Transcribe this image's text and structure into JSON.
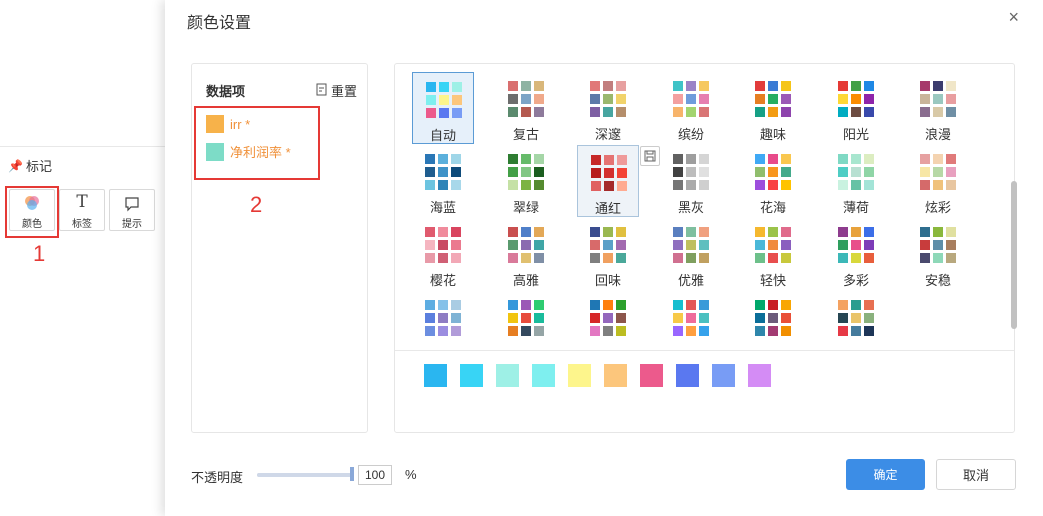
{
  "marks_panel": {
    "title": "标记",
    "buttons": [
      {
        "label": "颜色",
        "icon": "color-circles-icon"
      },
      {
        "label": "标签",
        "icon": "text-T-icon"
      },
      {
        "label": "提示",
        "icon": "tooltip-bubble-icon"
      }
    ],
    "annotation_1": "1"
  },
  "dialog": {
    "title": "颜色设置",
    "close_glyph": "×",
    "data_items": {
      "title": "数据项",
      "reset_label": "重置",
      "series": [
        {
          "label": "irr *",
          "color": "#f7b24a"
        },
        {
          "label": "净利润率 *",
          "color": "#7ddcc7"
        }
      ],
      "annotation_2": "2"
    },
    "schemes": [
      {
        "name": "自动",
        "colors": [
          "#2ab6f0",
          "#38d4f5",
          "#9ef0e6",
          "#7eefef",
          "#fdf58c",
          "#fcc67c",
          "#ec5a8c",
          "#5a78f0",
          "#789cf5"
        ]
      },
      {
        "name": "复古",
        "colors": [
          "#d96f6f",
          "#8fb3a3",
          "#d9b77a",
          "#6d6d6d",
          "#7ca4c6",
          "#f0a98a",
          "#5b8a6e",
          "#b4594f",
          "#8e7a9b"
        ]
      },
      {
        "name": "深邃",
        "colors": [
          "#e17878",
          "#c27e7e",
          "#e7a0a0",
          "#5d7aa8",
          "#9ab86e",
          "#f1d36b",
          "#7e5fa3",
          "#47a5a0",
          "#b58e6b"
        ]
      },
      {
        "name": "缤纷",
        "colors": [
          "#3fc3c7",
          "#9b83c7",
          "#f6c85f",
          "#f3a0a0",
          "#6f9cdc",
          "#e67fb0",
          "#f7b46b",
          "#a3d46f",
          "#d97575"
        ]
      },
      {
        "name": "趣味",
        "colors": [
          "#e23c3c",
          "#3a7bd5",
          "#f5c518",
          "#e67e22",
          "#27ae60",
          "#9b59b6",
          "#16a085",
          "#f39c12",
          "#8e44ad"
        ]
      },
      {
        "name": "阳光",
        "colors": [
          "#e53935",
          "#43a047",
          "#1e88e5",
          "#fdd835",
          "#fb8c00",
          "#8e24aa",
          "#00acc1",
          "#6d4c41",
          "#3949ab"
        ]
      },
      {
        "name": "浪漫",
        "colors": [
          "#a63a6b",
          "#3c3c6e",
          "#f0e6c8",
          "#c9b49a",
          "#9ac8c0",
          "#e89ea0",
          "#8a6d8f",
          "#d8c9a7",
          "#6f8fa5"
        ]
      },
      {
        "name": "海蓝",
        "colors": [
          "#2a77b6",
          "#5bb0dc",
          "#9fd6e8",
          "#1f5d8f",
          "#3f93c8",
          "#0e4b7a",
          "#6cc4e0",
          "#2e84b8",
          "#a8d8ea"
        ]
      },
      {
        "name": "翠绿",
        "colors": [
          "#2e7d32",
          "#66bb6a",
          "#a5d6a7",
          "#43a047",
          "#81c784",
          "#1b5e20",
          "#c5e1a5",
          "#7cb342",
          "#558b2f"
        ]
      },
      {
        "name": "通红",
        "colors": [
          "#c62828",
          "#e57373",
          "#ef9a9a",
          "#b71c1c",
          "#d32f2f",
          "#f44336",
          "#e06060",
          "#a52a2a",
          "#ffab91"
        ]
      },
      {
        "name": "黑灰",
        "colors": [
          "#616161",
          "#9e9e9e",
          "#d5d5d5",
          "#424242",
          "#bdbdbd",
          "#e0e0e0",
          "#757575",
          "#aaaaaa",
          "#cfcfcf"
        ]
      },
      {
        "name": "花海",
        "colors": [
          "#3fa9f5",
          "#e84a8a",
          "#f9c74f",
          "#90be6d",
          "#f8961e",
          "#43aa8b",
          "#9d4edd",
          "#f94144",
          "#ffc300"
        ]
      },
      {
        "name": "薄荷",
        "colors": [
          "#7fd9c4",
          "#a8e6cf",
          "#dcedc1",
          "#4ecdc4",
          "#b8e0d2",
          "#8fd5a6",
          "#c9f2e0",
          "#66c2a5",
          "#a3e4d7"
        ]
      },
      {
        "name": "炫彩",
        "colors": [
          "#e6a1a1",
          "#f4d3b0",
          "#e07a7a",
          "#f7e7a6",
          "#b7d8a6",
          "#e8a0bf",
          "#d56a6a",
          "#f0c27b",
          "#e8c6a0"
        ]
      },
      {
        "name": "樱花",
        "colors": [
          "#e05a6e",
          "#f08b9c",
          "#d9455f",
          "#f5b5c0",
          "#c94a63",
          "#eb7a8f",
          "#e89aa8",
          "#d06075",
          "#f2a8b6"
        ]
      },
      {
        "name": "高雅",
        "colors": [
          "#c94f4f",
          "#4f7fc9",
          "#e3a857",
          "#5a9a6e",
          "#8a6bb0",
          "#3fa6a6",
          "#d97a9a",
          "#e0c070",
          "#7f8fa6"
        ]
      },
      {
        "name": "回味",
        "colors": [
          "#3a4d8f",
          "#9ab850",
          "#e0c040",
          "#d86a6a",
          "#5aa0c8",
          "#a36ab0",
          "#7f7f7f",
          "#f0a060",
          "#4aa89a"
        ]
      },
      {
        "name": "优雅",
        "colors": [
          "#5a7fbf",
          "#7fbf9f",
          "#f0a07f",
          "#8f6fbf",
          "#bfbf5f",
          "#5fbfbf",
          "#d07090",
          "#7f9f5f",
          "#c0a060"
        ]
      },
      {
        "name": "轻快",
        "colors": [
          "#f5b82e",
          "#9bc34a",
          "#e06b8b",
          "#4ab8d8",
          "#f08a3c",
          "#8a5fbf",
          "#6dc08a",
          "#e84e4e",
          "#c8c83c"
        ]
      },
      {
        "name": "多彩",
        "colors": [
          "#8e3c8e",
          "#e8a23c",
          "#3c6ee8",
          "#2e9e5e",
          "#e84e8a",
          "#7e3cb8",
          "#3cb8b8",
          "#d8d83c",
          "#e85e3c"
        ]
      },
      {
        "name": "安稳",
        "colors": [
          "#2e6e8e",
          "#8ab83c",
          "#e0e0a0",
          "#c83c3c",
          "#5e8ea8",
          "#a87e5e",
          "#4a4a6e",
          "#8ed8b8",
          "#b8a87e"
        ]
      },
      {
        "name": "",
        "colors": [
          "#5dade2",
          "#85c1e9",
          "#a9cce3",
          "#5b7fde",
          "#8e7cc3",
          "#7fb3d5",
          "#6c8ee0",
          "#9b8de0",
          "#b19cd9"
        ]
      },
      {
        "name": "",
        "colors": [
          "#3498db",
          "#9b59b6",
          "#2ecc71",
          "#f1c40f",
          "#e74c3c",
          "#1abc9c",
          "#e67e22",
          "#34495e",
          "#95a5a6"
        ]
      },
      {
        "name": "",
        "colors": [
          "#1f77b4",
          "#ff7f0e",
          "#2ca02c",
          "#d62728",
          "#9467bd",
          "#8c564b",
          "#e377c2",
          "#7f7f7f",
          "#bcbd22"
        ]
      },
      {
        "name": "",
        "colors": [
          "#17becf",
          "#e45757",
          "#3a9ad9",
          "#f7c948",
          "#ef6c9b",
          "#4bc0c0",
          "#9966ff",
          "#ff9f40",
          "#36a2eb"
        ]
      },
      {
        "name": "",
        "colors": [
          "#00a86b",
          "#c81d25",
          "#f9a602",
          "#0b6e99",
          "#6c5b7b",
          "#e94f37",
          "#2e86ab",
          "#a23b72",
          "#f18f01"
        ]
      },
      {
        "name": "",
        "colors": [
          "#f4a261",
          "#2a9d8f",
          "#e76f51",
          "#264653",
          "#e9c46a",
          "#8ab17d",
          "#e63946",
          "#457b9d",
          "#1d3557"
        ]
      }
    ],
    "palette": [
      "#2ab6f0",
      "#38d4f5",
      "#9ef0e6",
      "#7eefef",
      "#fdf58c",
      "#fcc67c",
      "#ec5a8c",
      "#5a78f0",
      "#789cf5",
      "#d48cf5"
    ],
    "opacity": {
      "label": "不透明度",
      "value": "100",
      "unit": "%",
      "level": 1.0
    },
    "ok_label": "确定",
    "cancel_label": "取消"
  }
}
